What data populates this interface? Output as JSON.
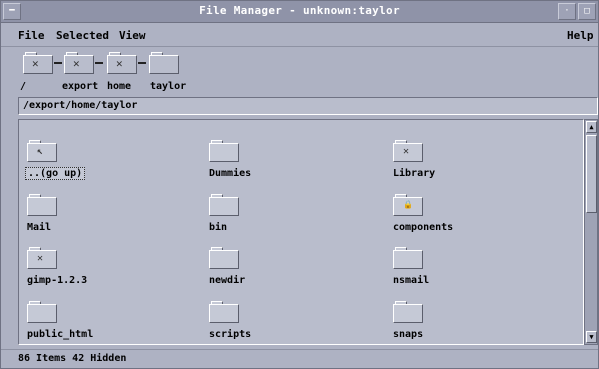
{
  "window": {
    "title": "File Manager - unknown:taylor"
  },
  "menu": {
    "file": "File",
    "selected": "Selected",
    "view": "View",
    "help": "Help"
  },
  "pathbar": {
    "root_label": "/",
    "export_label": "export",
    "home_label": "home",
    "taylor_label": "taylor"
  },
  "address": {
    "path": "/export/home/taylor"
  },
  "files": [
    {
      "name": "..(go up)",
      "icon": "go-up-folder-icon",
      "glyph": "↖"
    },
    {
      "name": "Dummies",
      "icon": "folder-icon",
      "glyph": ""
    },
    {
      "name": "Library",
      "icon": "folder-x-icon",
      "glyph": "✕"
    },
    {
      "name": "Mail",
      "icon": "folder-icon",
      "glyph": ""
    },
    {
      "name": "bin",
      "icon": "folder-icon",
      "glyph": ""
    },
    {
      "name": "components",
      "icon": "locked-folder-icon",
      "glyph": "🔒"
    },
    {
      "name": "gimp-1.2.3",
      "icon": "folder-x-icon",
      "glyph": "✕"
    },
    {
      "name": "newdir",
      "icon": "folder-icon",
      "glyph": ""
    },
    {
      "name": "nsmail",
      "icon": "folder-icon",
      "glyph": ""
    },
    {
      "name": "public_html",
      "icon": "folder-icon",
      "glyph": ""
    },
    {
      "name": "scripts",
      "icon": "folder-icon",
      "glyph": ""
    },
    {
      "name": "snaps",
      "icon": "folder-icon",
      "glyph": ""
    }
  ],
  "status": {
    "text": "86 Items 42 Hidden"
  },
  "colors": {
    "window_bg": "#aeb2c3",
    "titlebar": "#8f93a8",
    "file_area": "#b9bdcc"
  }
}
